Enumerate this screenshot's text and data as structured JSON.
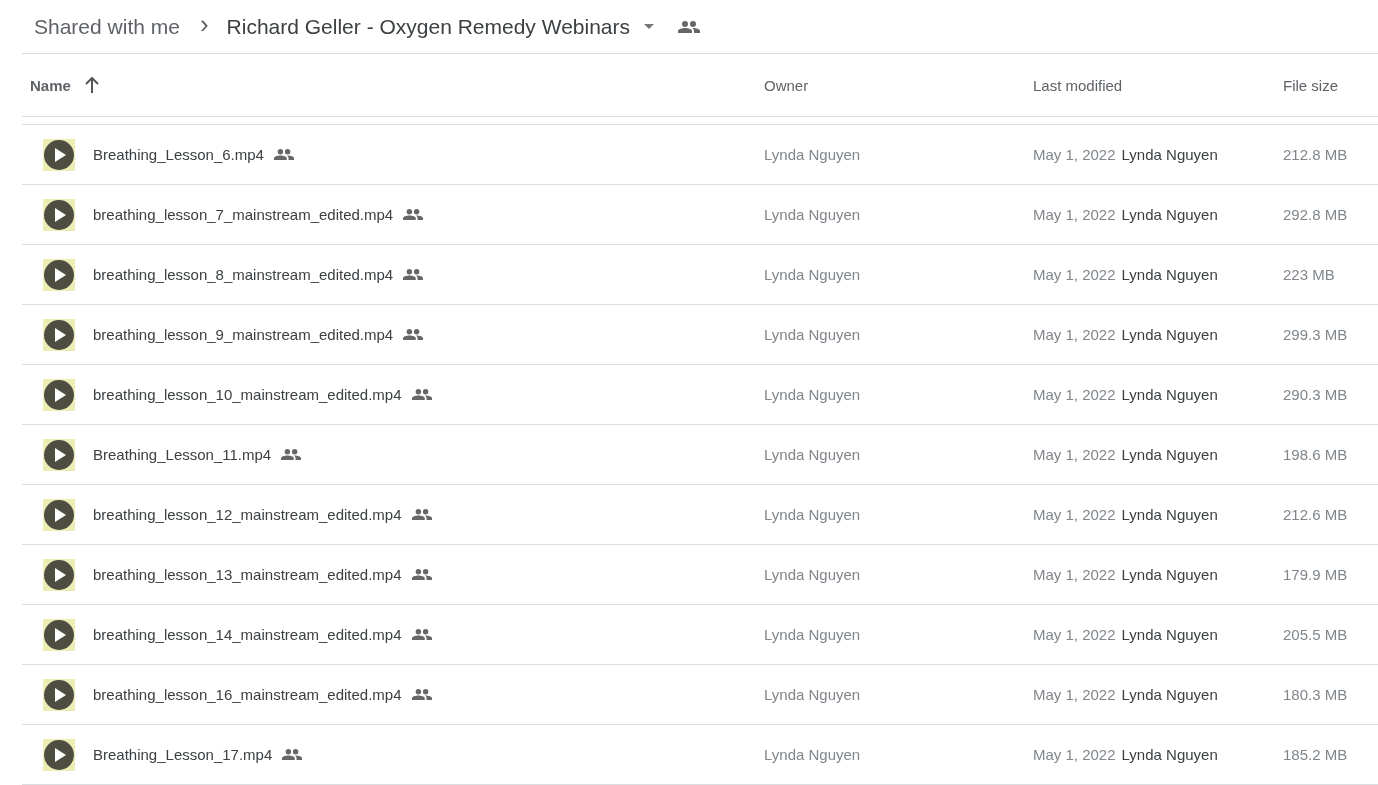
{
  "breadcrumb": {
    "parent": "Shared with me",
    "separator": "›",
    "current": "Richard Geller - Oxygen Remedy Webinars",
    "shared": true
  },
  "table": {
    "columns": [
      {
        "label": "Name",
        "sorted_ascending": true
      },
      {
        "label": "Owner"
      },
      {
        "label": "Last modified"
      },
      {
        "label": "File size"
      }
    ],
    "rows": [
      {
        "name": "Breathing_Lesson_6.mp4",
        "shared": true,
        "owner": "Lynda Nguyen",
        "modified": "May 1, 2022",
        "modified_by": "Lynda Nguyen",
        "size": "212.8 MB"
      },
      {
        "name": "breathing_lesson_7_mainstream_edited.mp4",
        "shared": true,
        "owner": "Lynda Nguyen",
        "modified": "May 1, 2022",
        "modified_by": "Lynda Nguyen",
        "size": "292.8 MB"
      },
      {
        "name": "breathing_lesson_8_mainstream_edited.mp4",
        "shared": true,
        "owner": "Lynda Nguyen",
        "modified": "May 1, 2022",
        "modified_by": "Lynda Nguyen",
        "size": "223 MB"
      },
      {
        "name": "breathing_lesson_9_mainstream_edited.mp4",
        "shared": true,
        "owner": "Lynda Nguyen",
        "modified": "May 1, 2022",
        "modified_by": "Lynda Nguyen",
        "size": "299.3 MB"
      },
      {
        "name": "breathing_lesson_10_mainstream_edited.mp4",
        "shared": true,
        "owner": "Lynda Nguyen",
        "modified": "May 1, 2022",
        "modified_by": "Lynda Nguyen",
        "size": "290.3 MB"
      },
      {
        "name": "Breathing_Lesson_11.mp4",
        "shared": true,
        "owner": "Lynda Nguyen",
        "modified": "May 1, 2022",
        "modified_by": "Lynda Nguyen",
        "size": "198.6 MB"
      },
      {
        "name": "breathing_lesson_12_mainstream_edited.mp4",
        "shared": true,
        "owner": "Lynda Nguyen",
        "modified": "May 1, 2022",
        "modified_by": "Lynda Nguyen",
        "size": "212.6 MB"
      },
      {
        "name": "breathing_lesson_13_mainstream_edited.mp4",
        "shared": true,
        "owner": "Lynda Nguyen",
        "modified": "May 1, 2022",
        "modified_by": "Lynda Nguyen",
        "size": "179.9 MB"
      },
      {
        "name": "breathing_lesson_14_mainstream_edited.mp4",
        "shared": true,
        "owner": "Lynda Nguyen",
        "modified": "May 1, 2022",
        "modified_by": "Lynda Nguyen",
        "size": "205.5 MB"
      },
      {
        "name": "breathing_lesson_16_mainstream_edited.mp4",
        "shared": true,
        "owner": "Lynda Nguyen",
        "modified": "May 1, 2022",
        "modified_by": "Lynda Nguyen",
        "size": "180.3 MB"
      },
      {
        "name": "Breathing_Lesson_17.mp4",
        "shared": true,
        "owner": "Lynda Nguyen",
        "modified": "May 1, 2022",
        "modified_by": "Lynda Nguyen",
        "size": "185.2 MB"
      }
    ]
  }
}
